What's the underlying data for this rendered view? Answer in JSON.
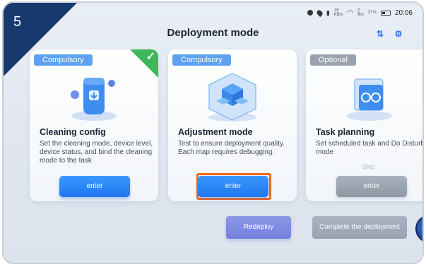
{
  "step": "5",
  "status_bar": {
    "signal_small_top": "46",
    "speed1_top": "16",
    "speed1_unit": "KB/s",
    "speed2_top": "0",
    "speed2_unit": "B/s",
    "battery": "37%",
    "time": "20:06"
  },
  "page_title": "Deployment mode",
  "cards": [
    {
      "badge": "Compulsory",
      "title": "Cleaning config",
      "description": "Set the cleaning mode, device level, device status, and bind the cleaning mode to the task",
      "button": "enter",
      "completed": true
    },
    {
      "badge": "Compulsory",
      "title": "Adjustment mode",
      "description": "Test to ensure deployment quality. Each map requires debugging.",
      "button": "enter",
      "highlighted": true
    },
    {
      "badge": "Optional",
      "title": "Task planning",
      "description": "Set scheduled task and Do Disturb mode",
      "skip": "Skip",
      "button": "enter"
    }
  ],
  "actions": {
    "redeploy": "Redeploy",
    "complete": "Complete the deployment"
  },
  "colors": {
    "flag": "#17396e",
    "primary_button": "#2a86f8",
    "highlight_border": "#f06a1a",
    "completed_check": "#3cb85a"
  }
}
